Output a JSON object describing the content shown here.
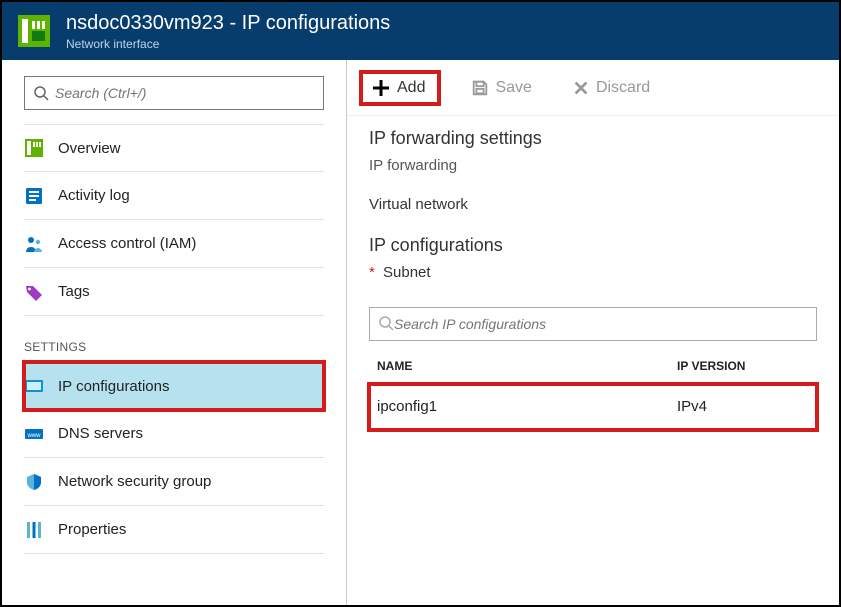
{
  "header": {
    "title": "nsdoc0330vm923 - IP configurations",
    "subtitle": "Network interface"
  },
  "search": {
    "placeholder": "Search (Ctrl+/)"
  },
  "nav": {
    "overview": "Overview",
    "activity": "Activity log",
    "access": "Access control (IAM)",
    "tags": "Tags"
  },
  "settings_label": "SETTINGS",
  "settings": {
    "ipconfig": "IP configurations",
    "dns": "DNS servers",
    "nsg": "Network security group",
    "props": "Properties"
  },
  "toolbar": {
    "add": "Add",
    "save": "Save",
    "discard": "Discard"
  },
  "content": {
    "fw_heading": "IP forwarding settings",
    "fw_label": "IP forwarding",
    "vnet_label": "Virtual network",
    "ipc_heading": "IP configurations",
    "subnet_label": "Subnet",
    "ipc_search_placeholder": "Search IP configurations",
    "col_name": "NAME",
    "col_version": "IP VERSION",
    "rows": [
      {
        "name": "ipconfig1",
        "version": "IPv4"
      }
    ]
  }
}
